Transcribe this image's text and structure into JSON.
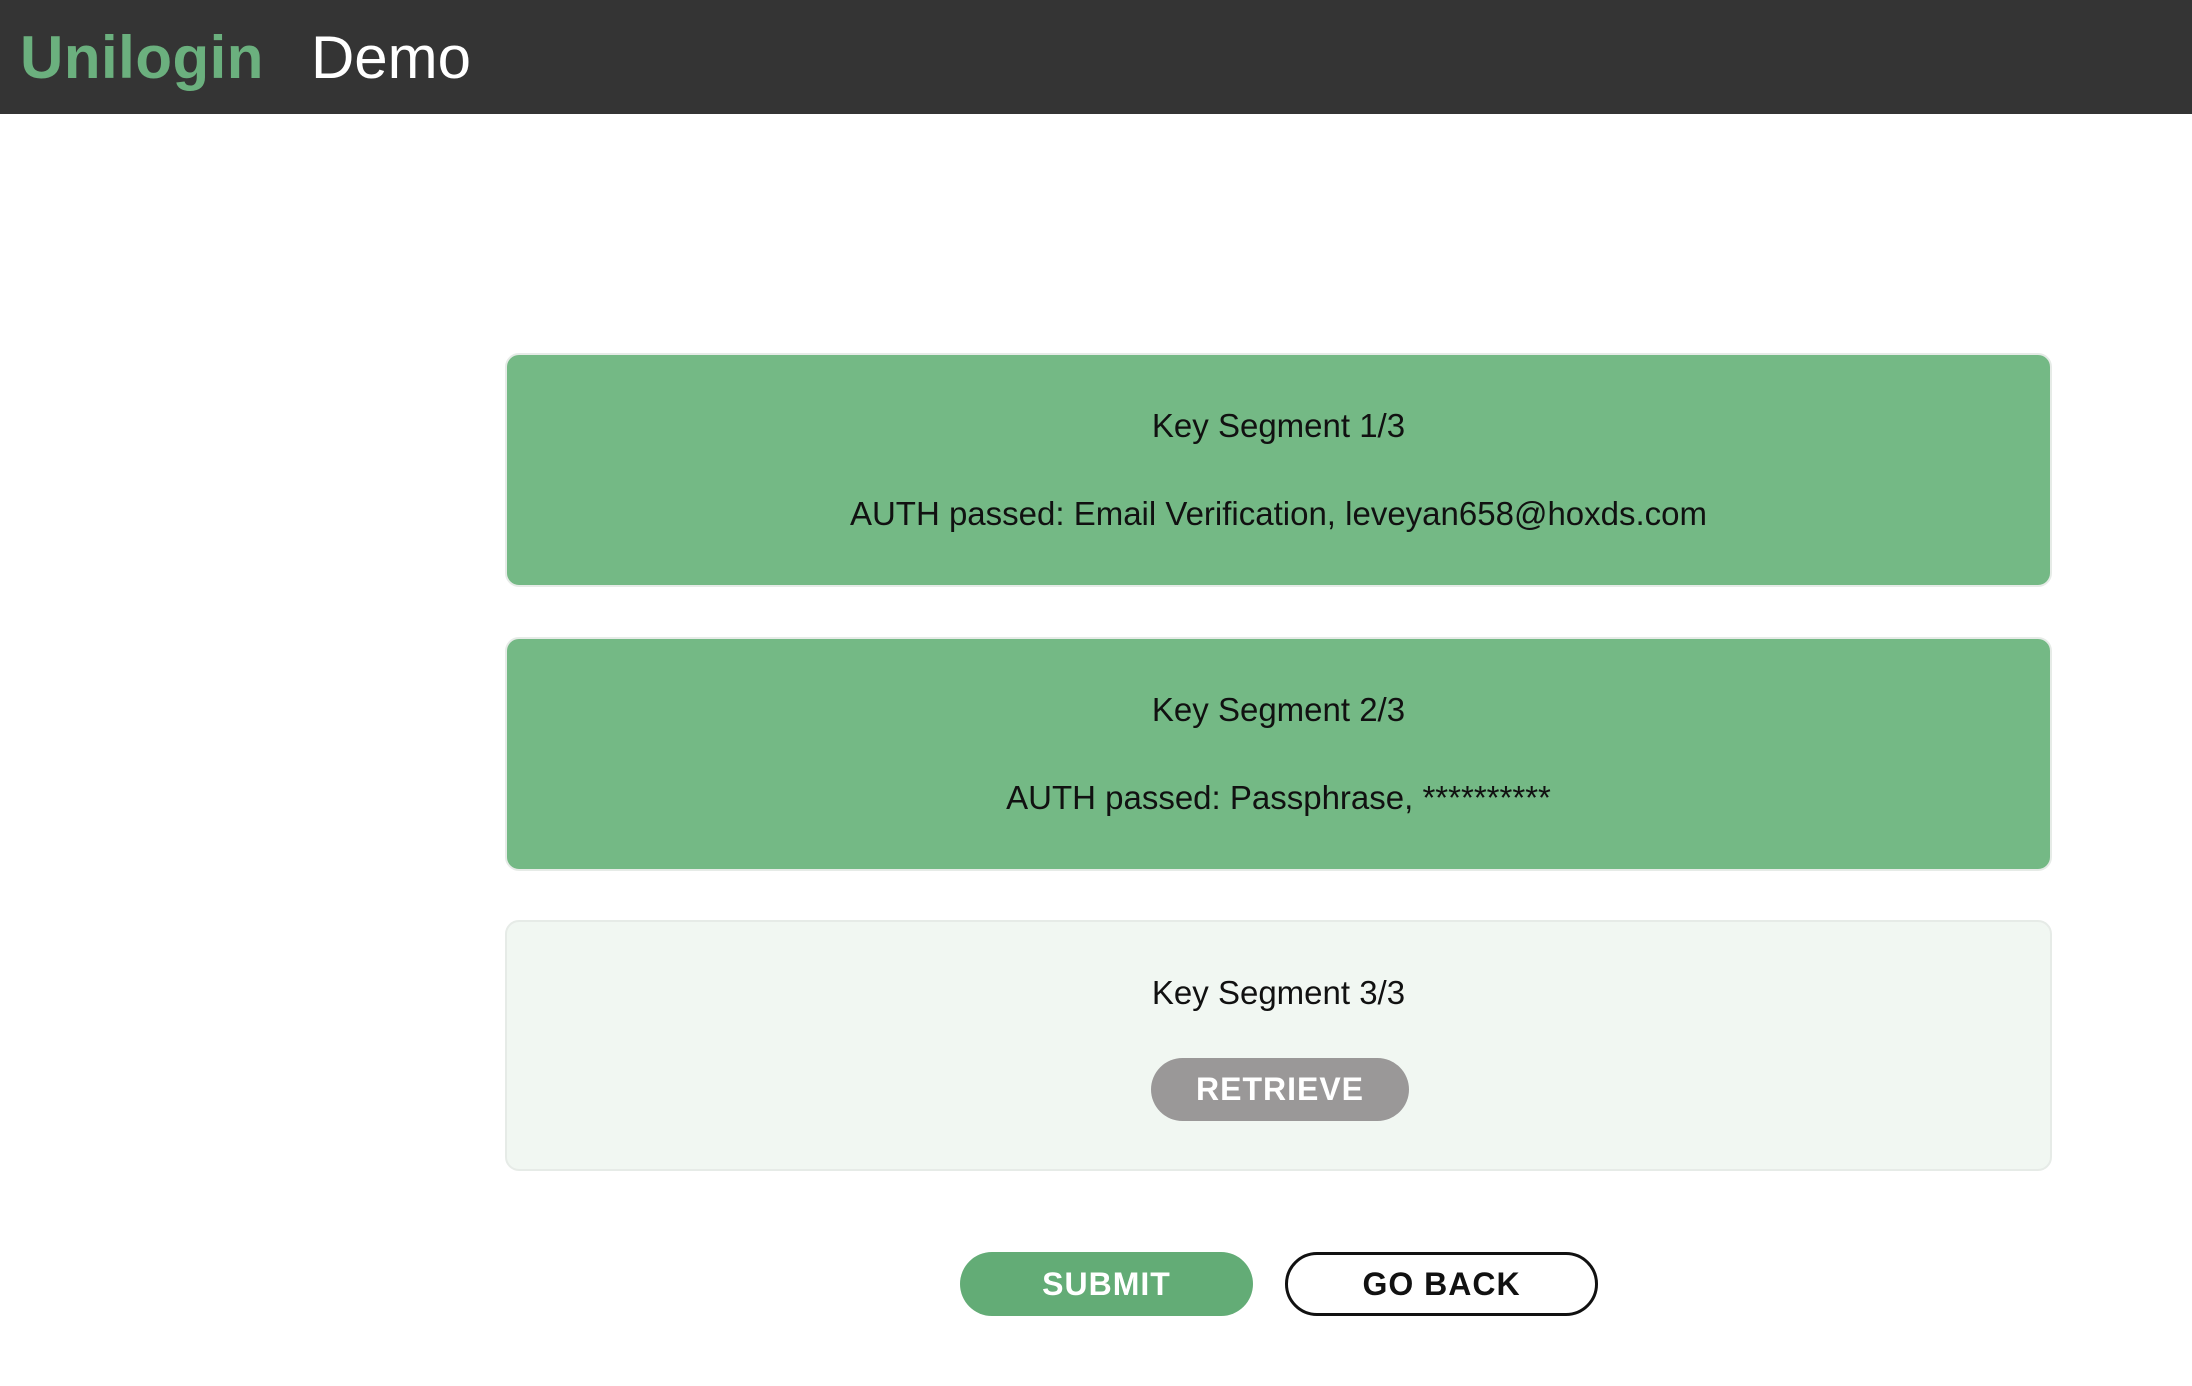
{
  "header": {
    "brand": "Unilogin",
    "subtitle": "Demo"
  },
  "segments": [
    {
      "title": "Key Segment 1/3",
      "status": "AUTH passed: Email Verification, leveyan658@hoxds.com"
    },
    {
      "title": "Key Segment 2/3",
      "status": "AUTH passed: Passphrase, **********"
    },
    {
      "title": "Key Segment 3/3",
      "button_label": "RETRIEVE"
    }
  ],
  "actions": {
    "submit_label": "SUBMIT",
    "go_back_label": "GO BACK"
  },
  "colors": {
    "header_bg": "#343434",
    "brand_green": "#6bb07e",
    "passed_card_bg": "#74b985",
    "pending_card_bg": "#f1f7f2",
    "retrieve_button_bg": "#9a9898",
    "submit_button_bg": "#63ac76"
  }
}
